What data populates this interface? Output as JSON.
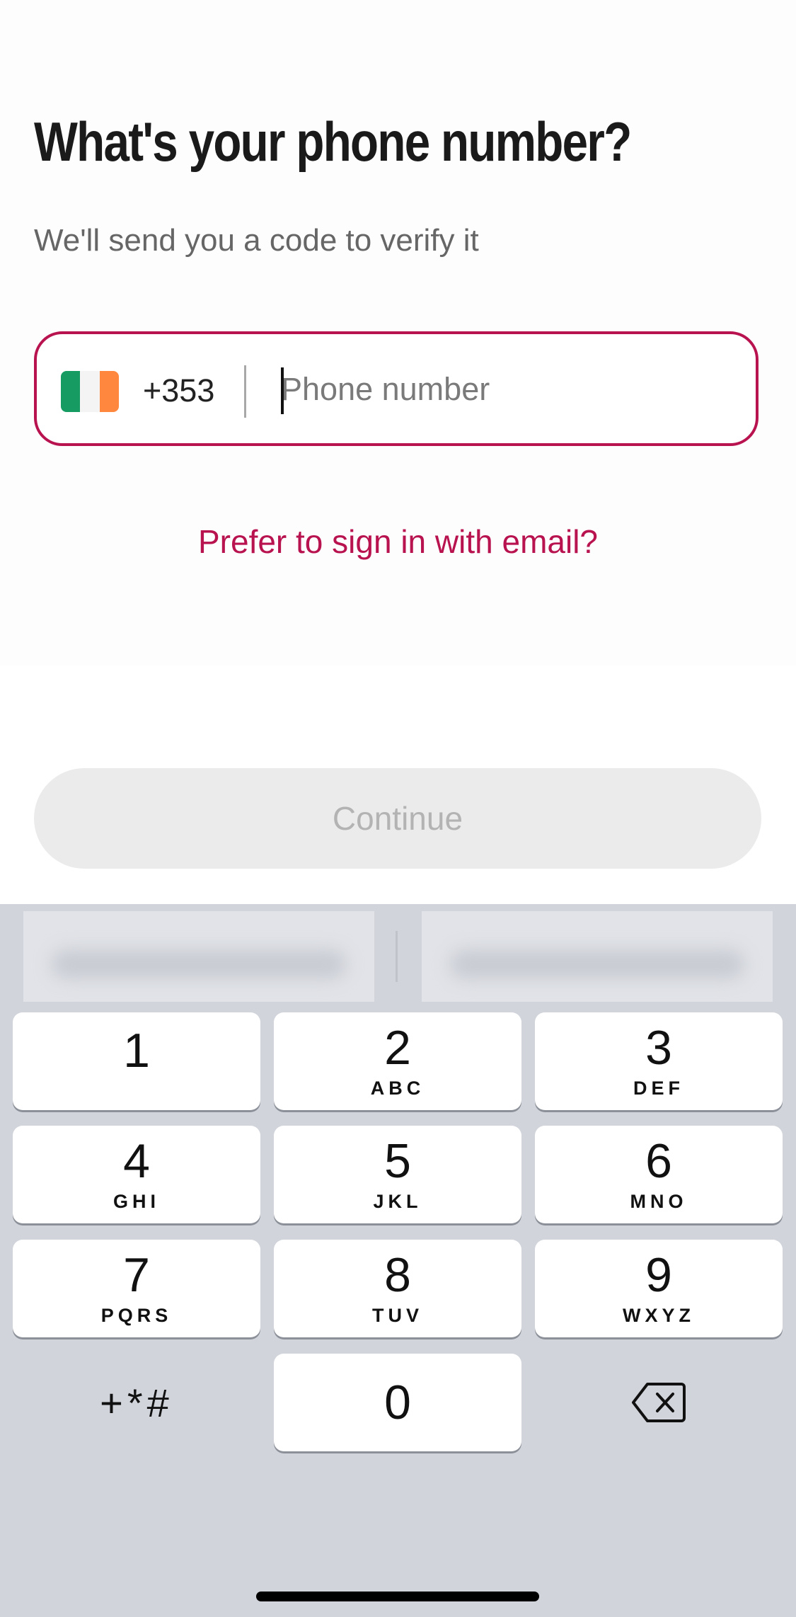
{
  "screen": {
    "title": "What's your phone number?",
    "subtitle": "We'll send you a code to verify it"
  },
  "phone_field": {
    "flag_icon": "ireland-flag-icon",
    "flag_colors": [
      "#169b62",
      "#ffffff",
      "#ff883e"
    ],
    "country_code": "+353",
    "value": "",
    "placeholder": "Phone number",
    "border_color": "#b8124f"
  },
  "email_link": {
    "label": "Prefer to sign in with email?",
    "color": "#b8124f"
  },
  "continue_button": {
    "label": "Continue",
    "state": "disabled"
  },
  "keyboard": {
    "keys": [
      {
        "digit": "1",
        "letters": ""
      },
      {
        "digit": "2",
        "letters": "ABC"
      },
      {
        "digit": "3",
        "letters": "DEF"
      },
      {
        "digit": "4",
        "letters": "GHI"
      },
      {
        "digit": "5",
        "letters": "JKL"
      },
      {
        "digit": "6",
        "letters": "MNO"
      },
      {
        "digit": "7",
        "letters": "PQRS"
      },
      {
        "digit": "8",
        "letters": "TUV"
      },
      {
        "digit": "9",
        "letters": "WXYZ"
      },
      {
        "digit": "0",
        "letters": ""
      }
    ],
    "symbols_label": "+*#",
    "delete_icon": "backspace-icon"
  }
}
